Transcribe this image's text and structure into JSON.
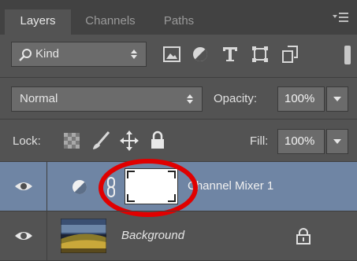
{
  "tabs": [
    "Layers",
    "Channels",
    "Paths"
  ],
  "filter": {
    "kind_label": "Kind"
  },
  "blend": {
    "mode": "Normal",
    "opacity_label": "Opacity:",
    "opacity_value": "100%"
  },
  "lock": {
    "label": "Lock:",
    "fill_label": "Fill:",
    "fill_value": "100%"
  },
  "layers": [
    {
      "name": "Channel Mixer 1",
      "selected": true,
      "visible": true
    },
    {
      "name": "Background",
      "selected": false,
      "visible": true,
      "locked": true
    }
  ],
  "colors": {
    "panel_bg": "#535353",
    "selected_row": "#6f85a4",
    "highlight_circle": "#e00000"
  }
}
